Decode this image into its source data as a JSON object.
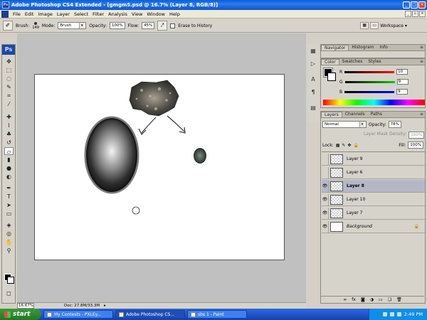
{
  "window": {
    "title": "Adobe Photoshop CS4 Extended - [gmgm5.psd @ 16.7% (Layer 8, RGB/8)]",
    "app_icon": "Ps"
  },
  "menu": [
    "File",
    "Edit",
    "Image",
    "Layer",
    "Select",
    "Filter",
    "Analysis",
    "View",
    "Window",
    "Help"
  ],
  "options": {
    "brush_label": "Brush:",
    "brush_size": "149",
    "mode_label": "Mode:",
    "mode_value": "Brush",
    "opacity_label": "Opacity:",
    "opacity_value": "100%",
    "flow_label": "Flow:",
    "flow_value": "45%",
    "erase_history_label": "Erase to History",
    "workspace_label": "Workspace"
  },
  "status": {
    "zoom": "16.67%",
    "doc": "Doc: 27.8M/33.3M"
  },
  "navigator": {
    "tabs": [
      "Navigator",
      "Histogram",
      "Info"
    ]
  },
  "color_panel": {
    "tabs": [
      "Color",
      "Swatches",
      "Styles"
    ],
    "r_label": "R",
    "r_value": "10",
    "g_label": "G",
    "g_value": "9",
    "b_label": "B",
    "b_value": "9"
  },
  "layers_panel": {
    "tabs": [
      "Layers",
      "Channels",
      "Paths"
    ],
    "blend_mode": "Normal",
    "opacity_label": "Opacity:",
    "opacity_value": "78%",
    "density_label": "Layer Mask Density:",
    "density_value": "100%",
    "lock_label": "Lock:",
    "fill_label": "Fill:",
    "fill_value": "100%",
    "layers": [
      {
        "name": "Layer 9",
        "visible": false
      },
      {
        "name": "Layer 6",
        "visible": false
      },
      {
        "name": "Layer 8",
        "visible": true,
        "selected": true
      },
      {
        "name": "Layer 10",
        "visible": true
      },
      {
        "name": "Layer 7",
        "visible": true
      },
      {
        "name": "Background",
        "visible": true,
        "locked": true
      }
    ]
  },
  "taskbar": {
    "start_label": "start",
    "tasks": [
      "My Contests - PXLEy...",
      "Adobe Photoshop CS...",
      "sbs 1 - Paint"
    ],
    "time": "2:49 PM"
  }
}
